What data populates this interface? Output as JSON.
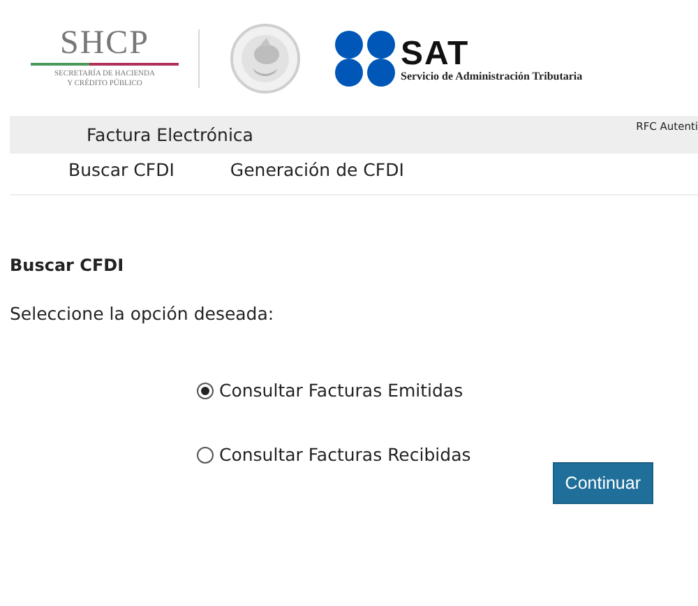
{
  "header": {
    "shcp": {
      "acronym": "SHCP",
      "subtitle_lines": [
        "SECRETARÍA DE HACIENDA",
        "Y CRÉDITO PÚBLICO"
      ]
    },
    "sat": {
      "acronym": "SAT",
      "subtitle": "Servicio de Administración Tributaria"
    }
  },
  "app_bar": {
    "title": "Factura Electrónica",
    "user_label": "RFC Autenti"
  },
  "nav": [
    {
      "label": "Buscar CFDI"
    },
    {
      "label": "Generación de CFDI"
    }
  ],
  "section": {
    "heading": "Buscar CFDI",
    "prompt": "Seleccione la opción deseada:"
  },
  "options": [
    {
      "label": "Consultar Facturas Emitidas",
      "selected": true
    },
    {
      "label": "Consultar Facturas Recibidas",
      "selected": false
    }
  ],
  "button": "Continuar"
}
